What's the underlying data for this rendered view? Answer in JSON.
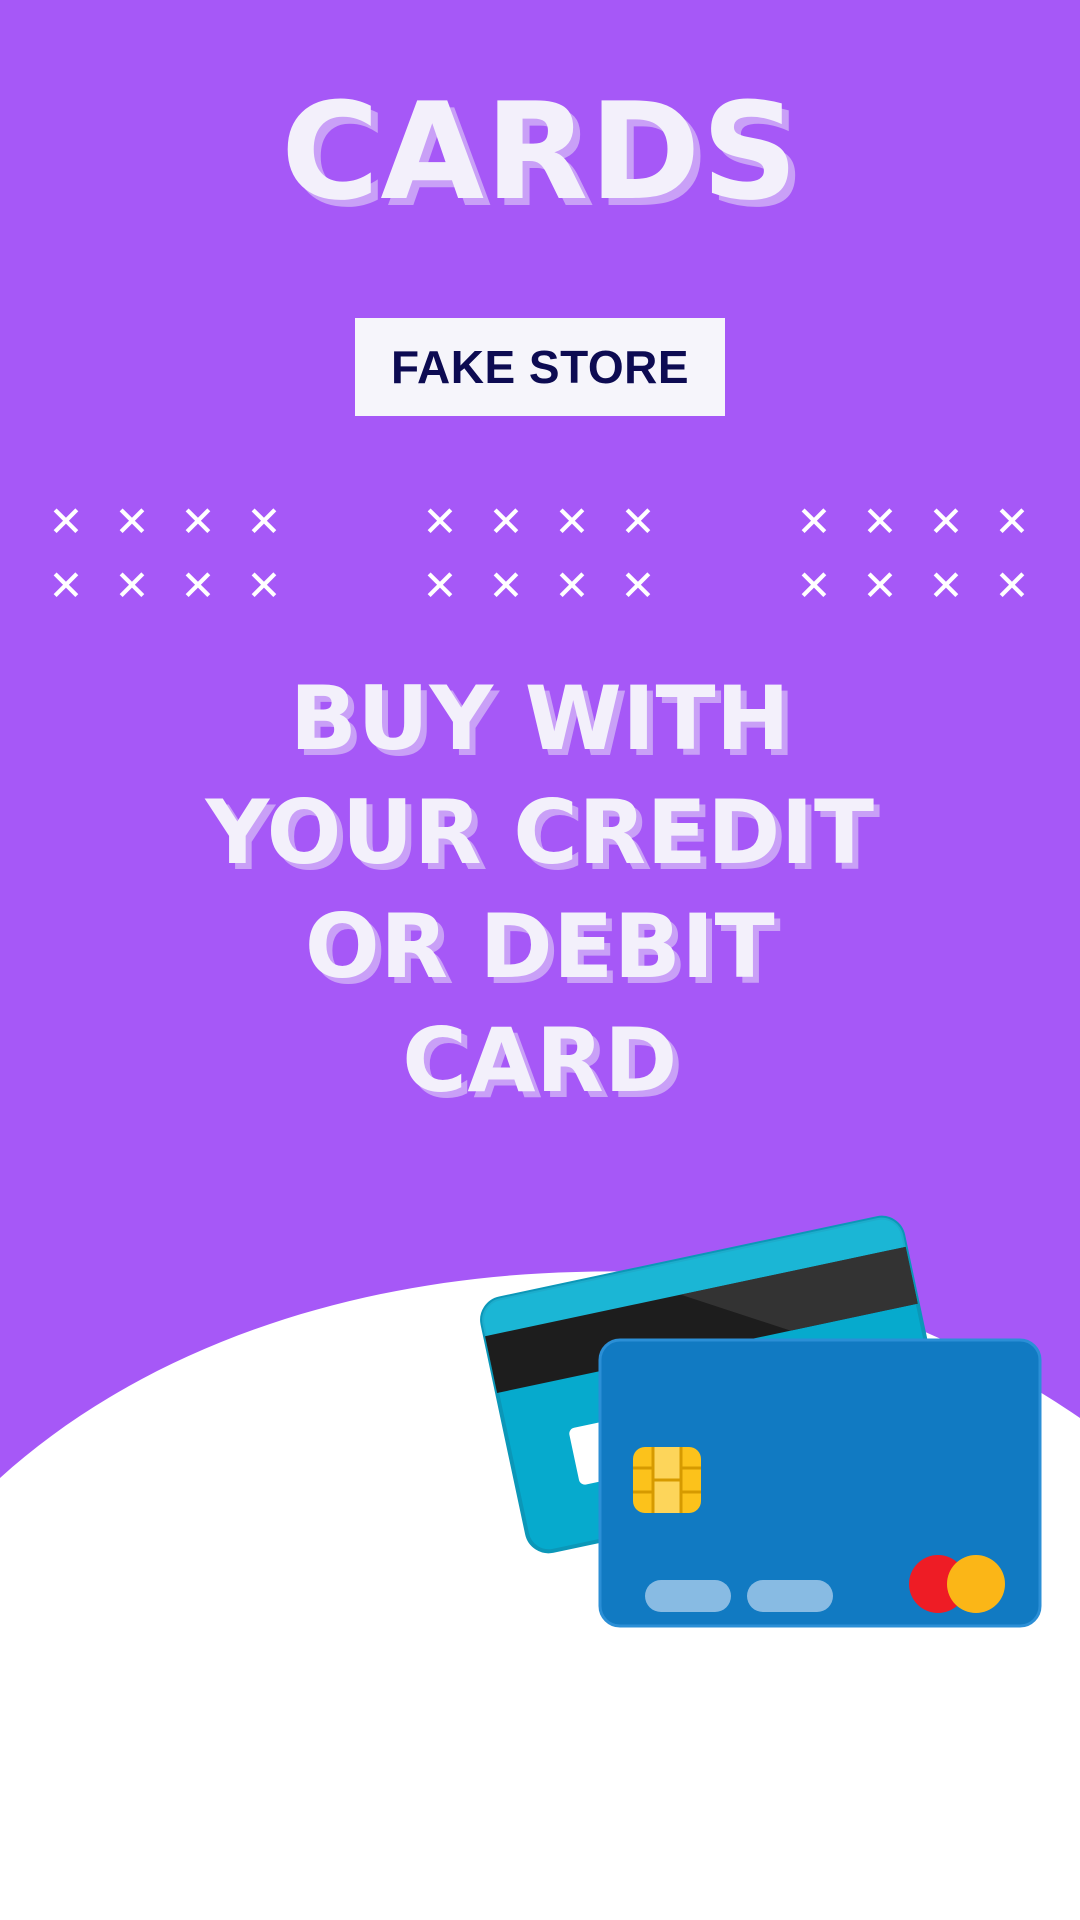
{
  "header": {
    "title": "CARDS"
  },
  "badge": {
    "label": "FAKE STORE"
  },
  "decor": {
    "mark_symbol": "✕",
    "groups": 3,
    "marks_per_group": 8
  },
  "tagline": {
    "lines": [
      "BUY WITH",
      "YOUR CREDIT",
      "OR DEBIT",
      "CARD"
    ]
  },
  "illustration": {
    "icons": [
      "credit-card-back-icon",
      "credit-card-front-icon",
      "chip-icon",
      "mastercard-logo-icon"
    ]
  },
  "colors": {
    "background_purple": "#a658f7",
    "text_light": "#f3f0fb",
    "text_shadow": "#c9a0f7",
    "badge_bg": "#f6f5fb",
    "badge_text": "#0d0b52",
    "card_front": "#117ac2",
    "card_back": "#06aacd",
    "stripe": "#1d1d1d",
    "chip": "#fcc21b",
    "mastercard_red": "#ee1c25",
    "mastercard_yellow": "#fbb617"
  }
}
